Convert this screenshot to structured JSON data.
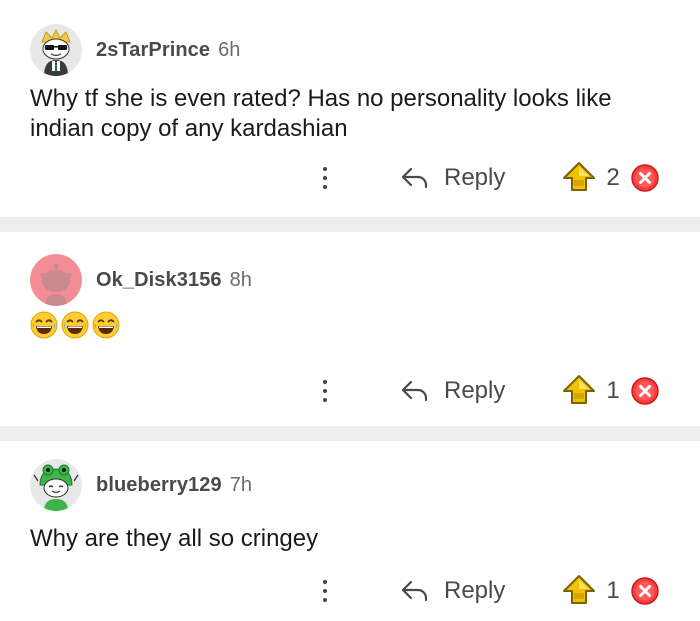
{
  "colors": {
    "divider": "#ededed",
    "upvote": "#e6b800",
    "downvote": "#ff3b3b",
    "text": "#1a1a1b",
    "meta": "#4a4a4a"
  },
  "comments": [
    {
      "username": "2sTarPrince",
      "age": "6h",
      "body": "Why tf she is even rated? Has no personality looks like indian copy of any kardashian",
      "avatar_icon": "snoo-sunglasses-avatar",
      "reply_label": "Reply",
      "score": "2"
    },
    {
      "username": "Ok_Disk3156",
      "age": "8h",
      "body_emojis": [
        "laughing-face-icon",
        "laughing-face-icon",
        "laughing-face-icon"
      ],
      "avatar_icon": "snoo-default-avatar",
      "reply_label": "Reply",
      "score": "1"
    },
    {
      "username": "blueberry129",
      "age": "7h",
      "body": "Why are they all so cringey",
      "avatar_icon": "snoo-frog-hat-avatar",
      "reply_label": "Reply",
      "score": "1"
    }
  ]
}
